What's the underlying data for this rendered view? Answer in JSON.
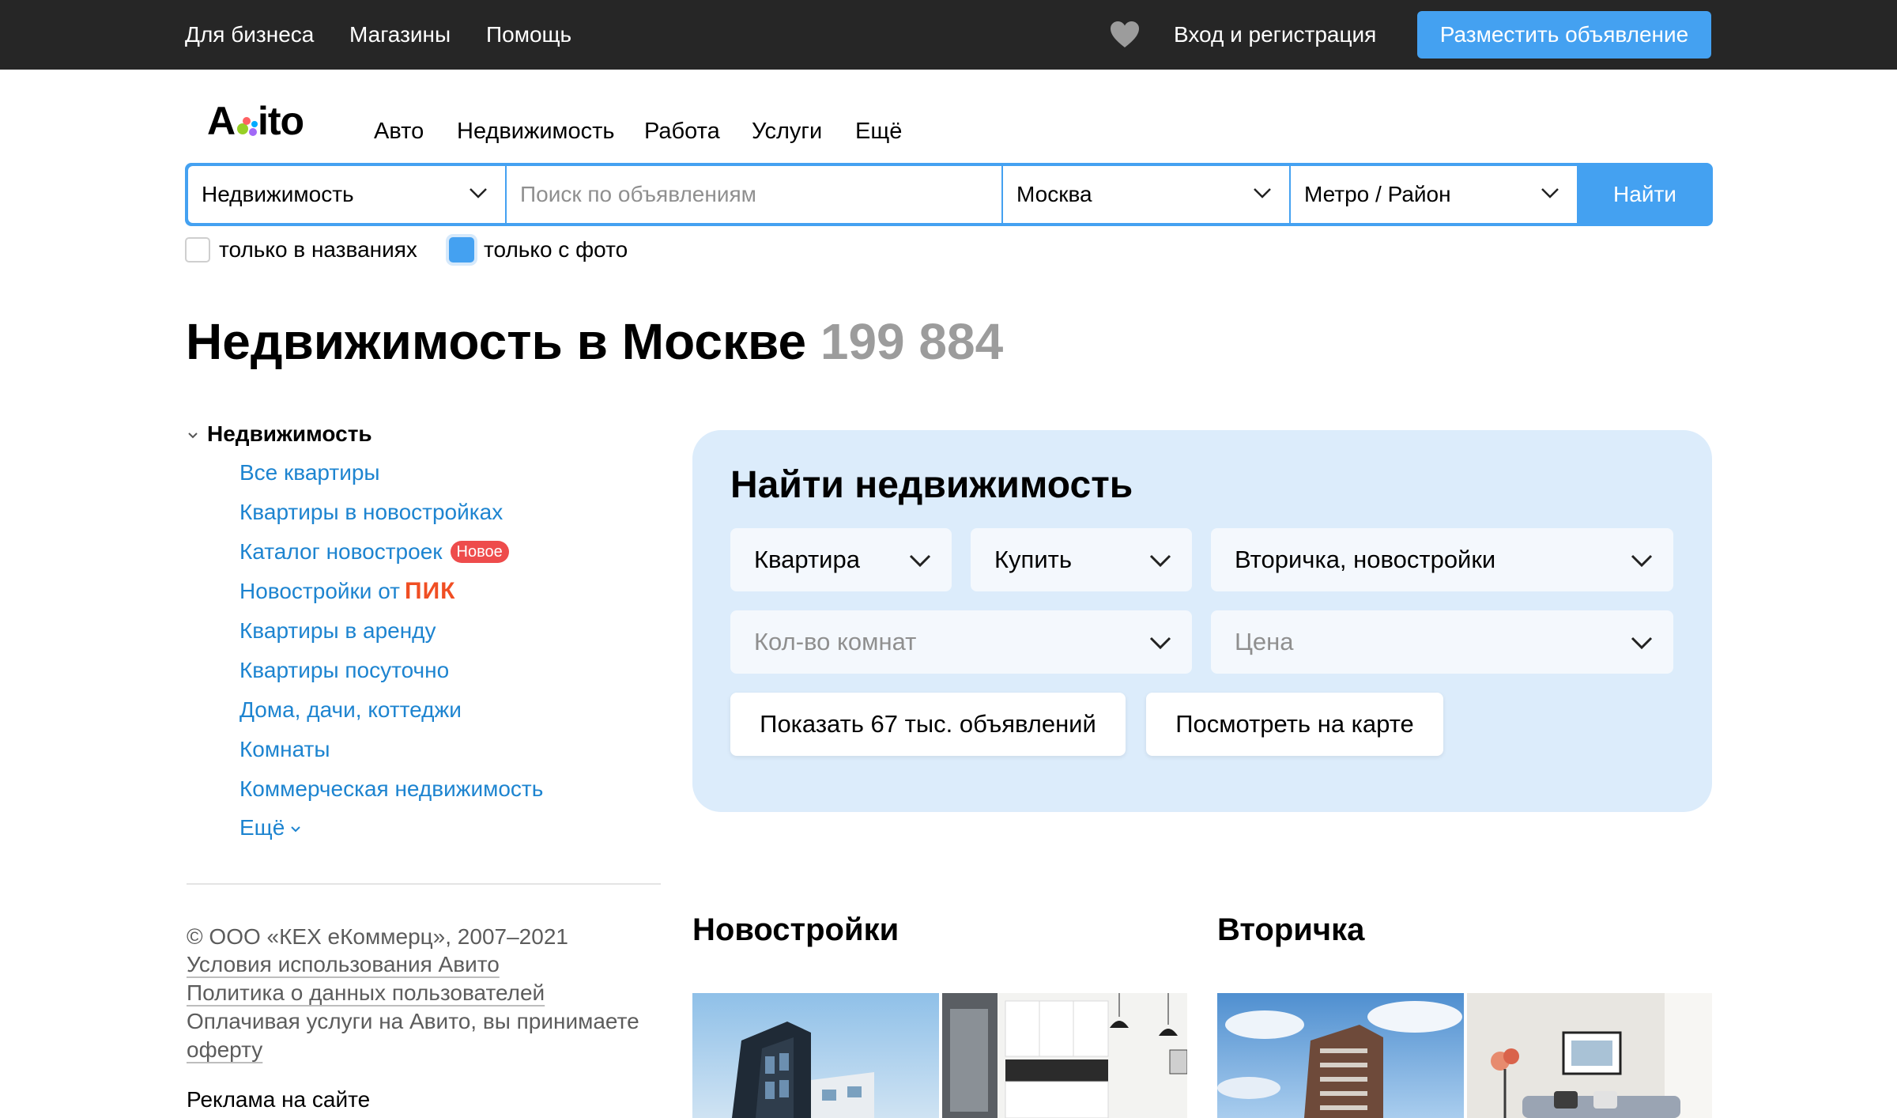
{
  "topbar": {
    "links": [
      "Для бизнеса",
      "Магазины",
      "Помощь"
    ],
    "login": "Вход и регистрация",
    "post_ad": "Разместить объявление"
  },
  "logo": {
    "text": "Avito"
  },
  "nav": [
    "Авто",
    "Недвижимость",
    "Работа",
    "Услуги",
    "Ещё"
  ],
  "search": {
    "category": "Недвижимость",
    "placeholder": "Поиск по объявлениям",
    "city": "Москва",
    "metro": "Метро / Район",
    "button": "Найти",
    "only_titles": "только в названиях",
    "only_photo": "только с фото",
    "only_titles_checked": false,
    "only_photo_checked": true
  },
  "page": {
    "title": "Недвижимость в Москве",
    "count": "199 884"
  },
  "sidebar": {
    "root": "Недвижимость",
    "items": [
      "Все квартиры",
      "Квартиры в новостройках",
      "Каталог новостроек",
      "Новостройки от",
      "Квартиры в аренду",
      "Квартиры посуточно",
      "Дома, дачи, коттеджи",
      "Комнаты",
      "Коммерческая недвижимость",
      "Ещё"
    ],
    "badge_new": "Новое",
    "pik": "ПИК",
    "footer": {
      "copyright": "© ООО «КЕХ еКоммерц», 2007–2021",
      "terms": "Условия использования Авито",
      "privacy": "Политика о данных пользователей",
      "offer_text": "Оплачивая услуги на Авито, вы принимаете",
      "offer_link": "оферту",
      "ads": "Реклама на сайте"
    }
  },
  "panel": {
    "title": "Найти недвижимость",
    "type": "Квартира",
    "deal": "Купить",
    "market": "Вторичка, новостройки",
    "rooms_placeholder": "Кол-во комнат",
    "price_placeholder": "Цена",
    "show_button": "Показать 67 тыс. объявлений",
    "map_button": "Посмотреть на карте"
  },
  "sections": {
    "new_buildings": "Новостройки",
    "secondary": "Вторичка"
  },
  "colors": {
    "accent": "#44a1f1",
    "link": "#1d84d0",
    "topbar": "#262626",
    "panel": "#dcecfb",
    "badge": "#ee4c4c",
    "pik": "#f04e23"
  }
}
